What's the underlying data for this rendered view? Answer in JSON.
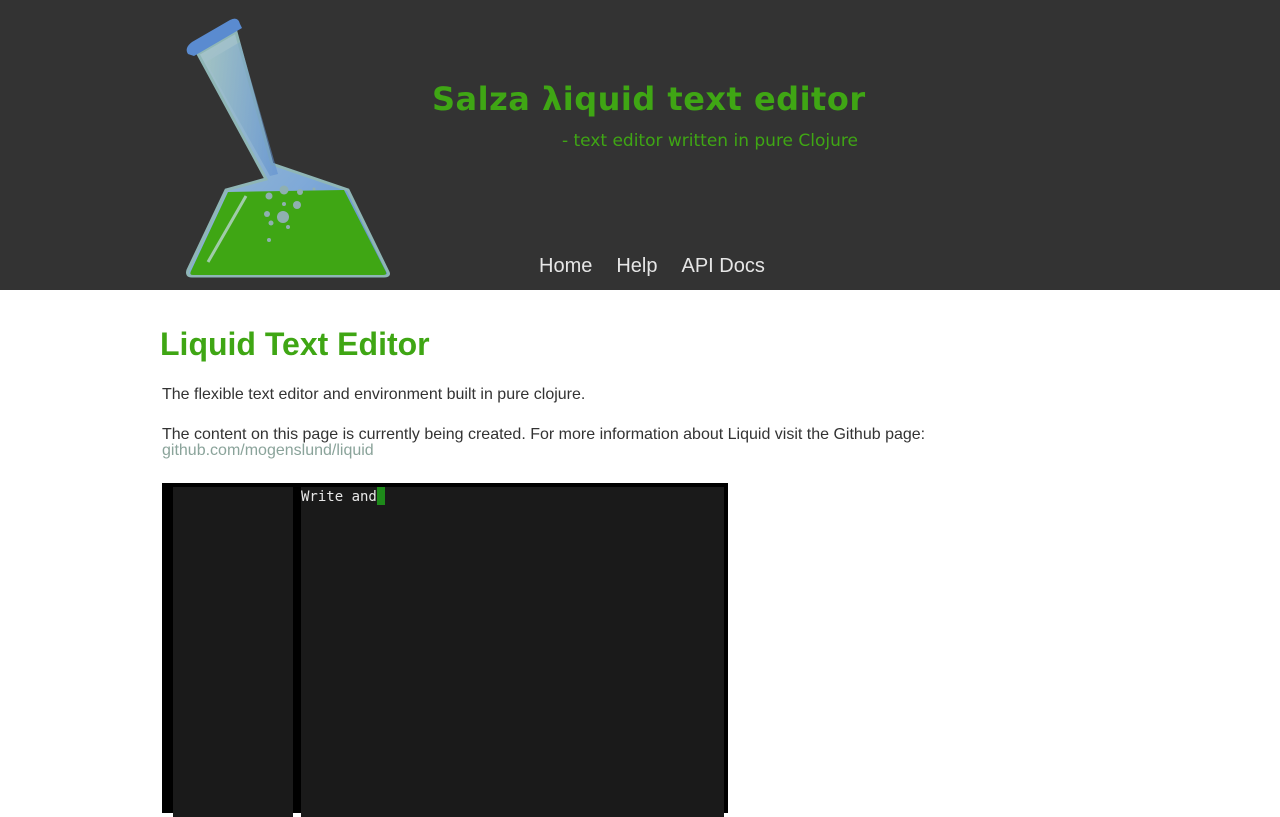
{
  "header": {
    "title": "Salza λiquid text editor",
    "subtitle": "- text editor written in pure Clojure",
    "nav": [
      "Home",
      "Help",
      "API Docs"
    ],
    "logo_icon": "flask-icon",
    "accent_color": "#3fa614",
    "background_color": "#333333"
  },
  "main": {
    "heading": "Liquid Text Editor",
    "intro": "The flexible text editor and environment built in pure clojure.",
    "info": "The content on this page is currently being created. For more information about Liquid visit the Github page:",
    "link_text": "github.com/mogenslund/liquid",
    "link_color": "#8aa39a"
  },
  "editor": {
    "text": "Write and",
    "cursor_color": "#1e8a1a"
  }
}
